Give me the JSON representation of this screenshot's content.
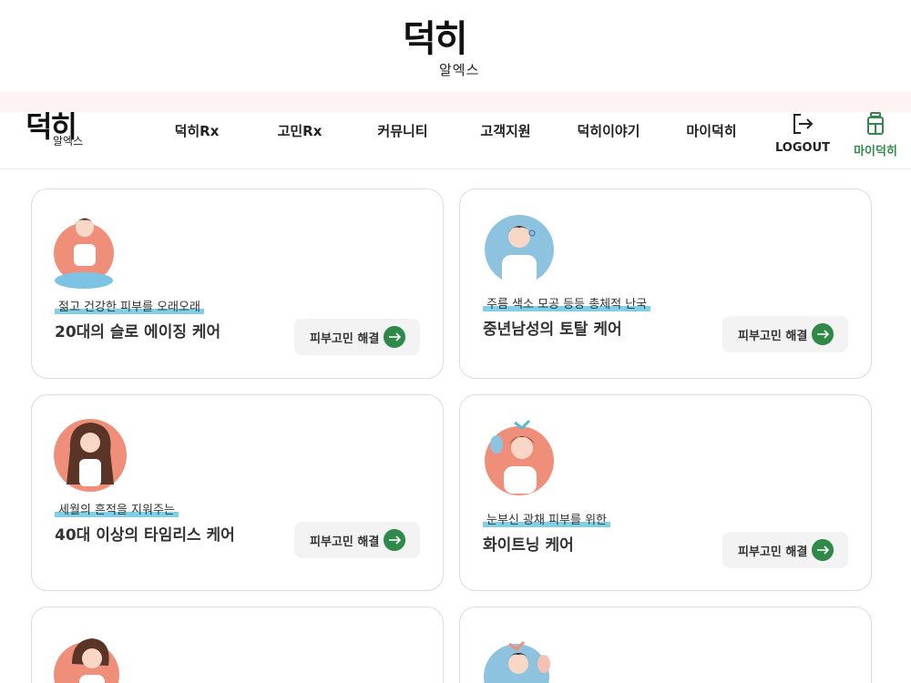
{
  "header": {
    "brand": "덕히",
    "brand_sub": "알엑스"
  },
  "nav": {
    "brand": "덕히",
    "brand_sub": "알엑스",
    "items": [
      {
        "label": "덕히Rx"
      },
      {
        "label": "고민Rx"
      },
      {
        "label": "커뮤니티"
      },
      {
        "label": "고객지원"
      },
      {
        "label": "덕히이야기"
      },
      {
        "label": "마이덕히"
      }
    ],
    "logout_label": "LOGOUT",
    "mydeokhi_label": "마이덕히",
    "accent_green": "#2f8a4a"
  },
  "cards": [
    {
      "tagline": "젊고 건강한 피부를 오래오래",
      "title": "20대의 슬로 에이징 케어",
      "button": "피부고민 해결",
      "avatar": "yoga-woman-avatar"
    },
    {
      "tagline": "주름 색소 모공 등등 총체적 난국",
      "title": "중년남성의 토탈 케어",
      "button": "피부고민 해결",
      "avatar": "man-touching-face-avatar"
    },
    {
      "tagline": "세월의 흔적을 지워주는",
      "title": "40대 이상의 타임리스 케어",
      "button": "피부고민 해결",
      "avatar": "long-hair-woman-avatar"
    },
    {
      "tagline": "눈부신 광채 피부를 위한",
      "title": "화이트닝 케어",
      "button": "피부고민 해결",
      "avatar": "woman-with-mirror-avatar"
    },
    {
      "avatar": "woman-avatar"
    },
    {
      "avatar": "woman-with-bow-avatar"
    }
  ],
  "colors": {
    "highlight": "#7fd0e6",
    "pink_strip": "#fdf3f2",
    "button_bg": "#f3f3f3"
  }
}
